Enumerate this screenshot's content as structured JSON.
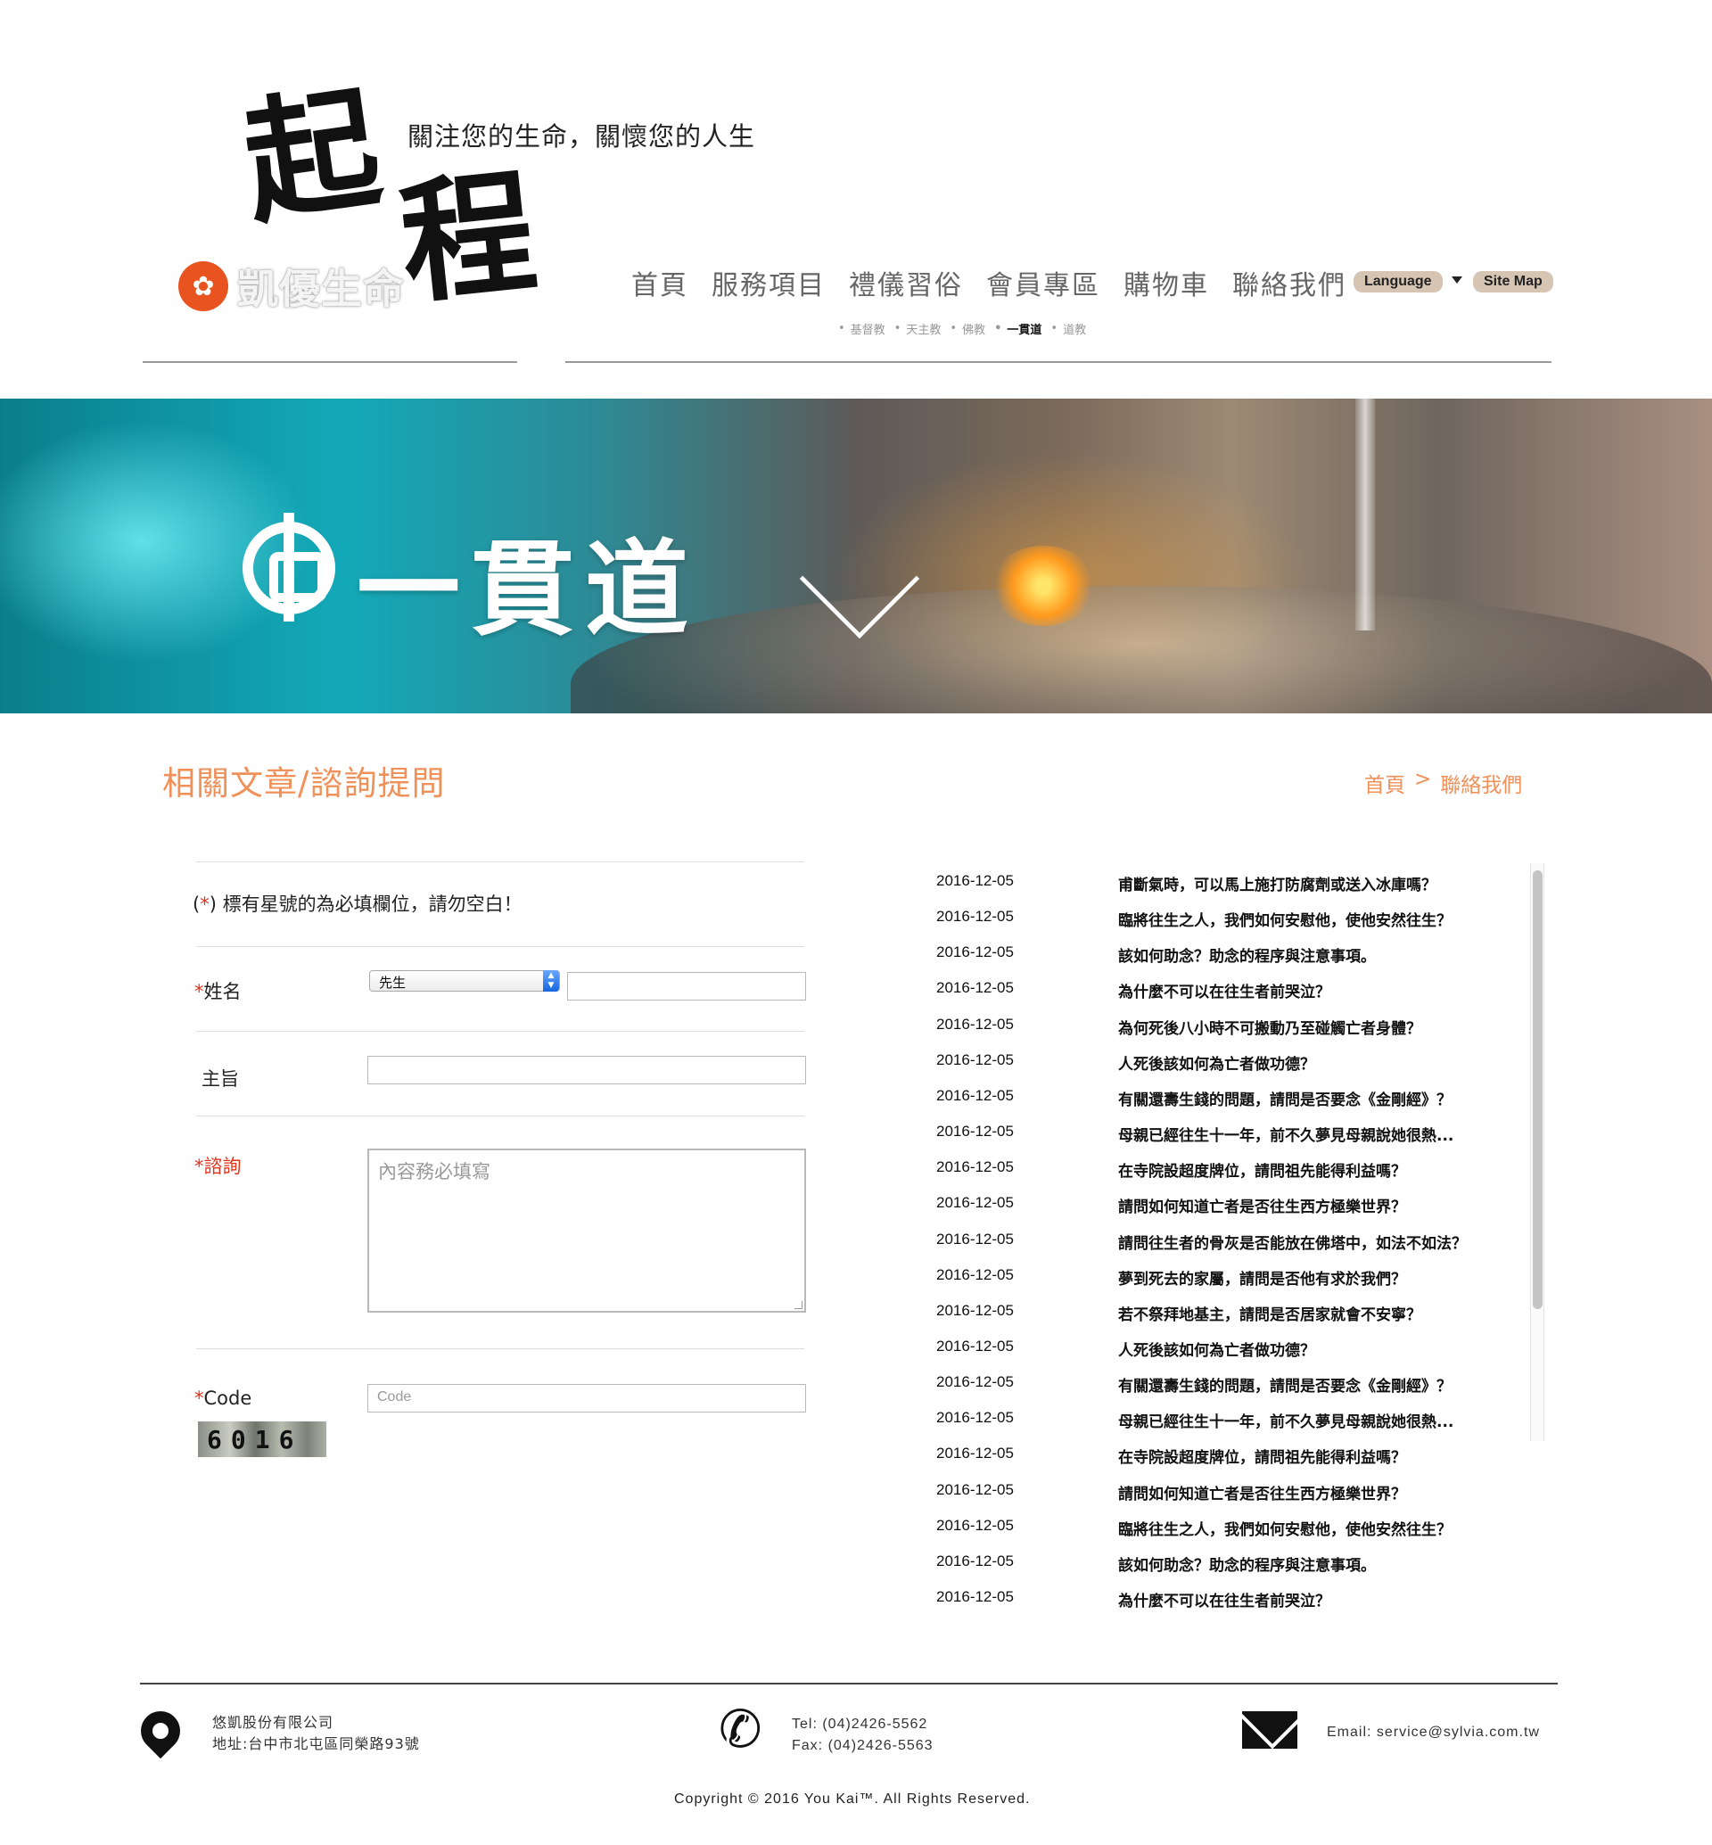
{
  "header": {
    "logo_calligraphy_1": "起",
    "logo_calligraphy_2": "程",
    "brand_name": "凱優生命",
    "tagline": "關注您的生命，關懷您的人生"
  },
  "nav": {
    "items": [
      "首頁",
      "服務項目",
      "禮儀習俗",
      "會員專區",
      "購物車",
      "聯絡我們"
    ],
    "language_label": "Language",
    "sitemap_label": "Site Map"
  },
  "sub_nav": {
    "items": [
      "基督教",
      "天主教",
      "佛教",
      "一貫道",
      "道教"
    ],
    "active": "一貫道"
  },
  "banner": {
    "title": "一貫道"
  },
  "content": {
    "page_title": "相關文章/諮詢提問",
    "breadcrumb_home": "首頁",
    "breadcrumb_sep": ">",
    "breadcrumb_current": "聯絡我們"
  },
  "form": {
    "note_prefix": "(",
    "note_star": "*",
    "note_text": ")  標有星號的為必填欄位，請勿空白！",
    "name_label": "姓名",
    "title_select_value": "先生",
    "subject_label": "主旨",
    "inquiry_label": "諮詢",
    "inquiry_placeholder": "內容務必填寫",
    "code_label": "Code",
    "code_placeholder": "Code",
    "captcha_text": "6016",
    "required_mark": "*"
  },
  "articles": [
    {
      "date": "2016-12-05",
      "title": "甫斷氣時，可以馬上施打防腐劑或送入冰庫嗎？"
    },
    {
      "date": "2016-12-05",
      "title": "臨將往生之人，我們如何安慰他，使他安然往生？"
    },
    {
      "date": "2016-12-05",
      "title": "該如何助念？助念的程序與注意事項。"
    },
    {
      "date": "2016-12-05",
      "title": "為什麼不可以在往生者前哭泣？"
    },
    {
      "date": "2016-12-05",
      "title": "為何死後八小時不可搬動乃至碰觸亡者身體？"
    },
    {
      "date": "2016-12-05",
      "title": "人死後該如何為亡者做功德？"
    },
    {
      "date": "2016-12-05",
      "title": "有關還壽生錢的問題，請問是否要念《金剛經》？"
    },
    {
      "date": "2016-12-05",
      "title": "母親已經往生十一年，前不久夢見母親說她很熱..."
    },
    {
      "date": "2016-12-05",
      "title": "在寺院設超度牌位，請問祖先能得利益嗎？"
    },
    {
      "date": "2016-12-05",
      "title": "請問如何知道亡者是否往生西方極樂世界？"
    },
    {
      "date": "2016-12-05",
      "title": "請問往生者的骨灰是否能放在佛塔中，如法不如法？"
    },
    {
      "date": "2016-12-05",
      "title": "夢到死去的家屬，請問是否他有求於我們？"
    },
    {
      "date": "2016-12-05",
      "title": "若不祭拜地基主，請問是否居家就會不安寧？"
    },
    {
      "date": "2016-12-05",
      "title": "人死後該如何為亡者做功德？"
    },
    {
      "date": "2016-12-05",
      "title": "有關還壽生錢的問題，請問是否要念《金剛經》？"
    },
    {
      "date": "2016-12-05",
      "title": "母親已經往生十一年，前不久夢見母親說她很熱..."
    },
    {
      "date": "2016-12-05",
      "title": "在寺院設超度牌位，請問祖先能得利益嗎？"
    },
    {
      "date": "2016-12-05",
      "title": "請問如何知道亡者是否往生西方極樂世界？"
    },
    {
      "date": "2016-12-05",
      "title": "臨將往生之人，我們如何安慰他，使他安然往生？"
    },
    {
      "date": "2016-12-05",
      "title": "該如何助念？助念的程序與注意事項。"
    },
    {
      "date": "2016-12-05",
      "title": "為什麼不可以在往生者前哭泣？"
    }
  ],
  "footer": {
    "company": "悠凱股份有限公司",
    "address": "地址:台中市北屯區同榮路93號",
    "tel": "Tel: (04)2426-5562",
    "fax": "Fax: (04)2426-5563",
    "email": "Email: service@sylvia.com.tw",
    "copyright": "Copyright © 2016 You Kai™. All Rights Reserved."
  },
  "colors": {
    "accent": "#f0915a",
    "required": "#e2321a",
    "nav_text": "#666666",
    "util_button": "#d7c5b4"
  },
  "icons": [
    "phoenix-logo-icon",
    "location-pin-icon",
    "phone-icon",
    "mail-icon",
    "dropdown-caret-icon",
    "chevron-down-icon"
  ]
}
